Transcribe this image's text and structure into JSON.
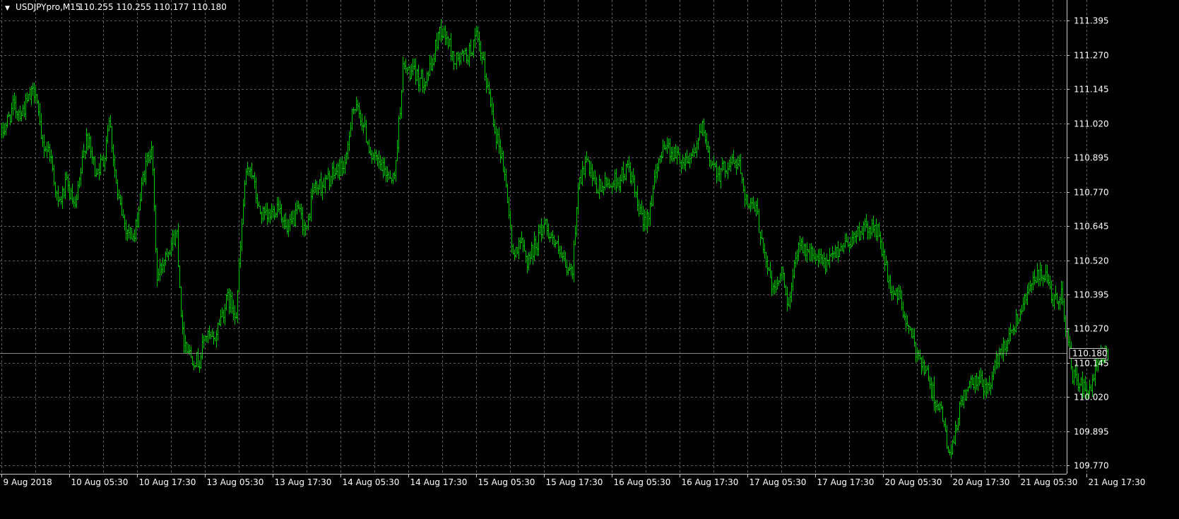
{
  "header": {
    "symbol_label": "USDJPYpro,M15",
    "quote_values": "110.255 110.255 110.177 110.180",
    "collapse_glyph": "▼"
  },
  "colors": {
    "background": "#000000",
    "bars": "#00c800",
    "grid": "#5a5a5a",
    "axis": "#c8c8c8",
    "text": "#ffffff",
    "current_price_line": "#8a8a8a"
  },
  "chart_data": {
    "type": "bar",
    "series": [
      {
        "name": "USDJPYpro,M15"
      }
    ],
    "current_price": 110.18,
    "current_price_label": "110.180",
    "ylim": [
      109.74,
      111.46
    ],
    "grid": true,
    "y_tick_values": [
      111.395,
      111.27,
      111.145,
      111.02,
      110.895,
      110.77,
      110.645,
      110.52,
      110.395,
      110.27,
      110.145,
      110.02,
      109.895,
      109.77
    ],
    "y_tick_labels": [
      "111.395",
      "111.270",
      "111.145",
      "111.020",
      "110.895",
      "110.770",
      "110.645",
      "110.520",
      "110.395",
      "110.270",
      "110.145",
      "110.020",
      "109.895",
      "109.770"
    ],
    "x_tick_labels": [
      "9 Aug 2018",
      "10 Aug 05:30",
      "10 Aug 17:30",
      "13 Aug 05:30",
      "13 Aug 17:30",
      "14 Aug 05:30",
      "14 Aug 17:30",
      "15 Aug 05:30",
      "15 Aug 17:30",
      "16 Aug 05:30",
      "16 Aug 17:30",
      "17 Aug 05:30",
      "17 Aug 17:30",
      "20 Aug 05:30",
      "20 Aug 17:30",
      "21 Aug 05:30",
      "21 Aug 17:30"
    ],
    "x_tick_index": [
      0,
      48,
      96,
      144,
      192,
      240,
      288,
      336,
      384,
      432,
      480,
      528,
      576,
      624,
      672,
      720,
      768
    ],
    "bar_count": 800,
    "close_anchors": [
      [
        0,
        110.98
      ],
      [
        8,
        111.08
      ],
      [
        14,
        111.06
      ],
      [
        24,
        111.15
      ],
      [
        28,
        110.95
      ],
      [
        34,
        110.92
      ],
      [
        40,
        110.72
      ],
      [
        46,
        110.8
      ],
      [
        52,
        110.7
      ],
      [
        60,
        110.98
      ],
      [
        66,
        110.85
      ],
      [
        72,
        110.88
      ],
      [
        76,
        111.05
      ],
      [
        82,
        110.75
      ],
      [
        88,
        110.64
      ],
      [
        94,
        110.6
      ],
      [
        100,
        110.82
      ],
      [
        106,
        110.95
      ],
      [
        110,
        110.45
      ],
      [
        116,
        110.55
      ],
      [
        124,
        110.62
      ],
      [
        128,
        110.25
      ],
      [
        134,
        110.17
      ],
      [
        140,
        110.15
      ],
      [
        144,
        110.25
      ],
      [
        150,
        110.22
      ],
      [
        154,
        110.3
      ],
      [
        160,
        110.38
      ],
      [
        166,
        110.33
      ],
      [
        172,
        110.8
      ],
      [
        176,
        110.87
      ],
      [
        182,
        110.7
      ],
      [
        188,
        110.67
      ],
      [
        196,
        110.73
      ],
      [
        202,
        110.62
      ],
      [
        210,
        110.7
      ],
      [
        216,
        110.62
      ],
      [
        220,
        110.78
      ],
      [
        228,
        110.8
      ],
      [
        236,
        110.84
      ],
      [
        244,
        110.88
      ],
      [
        248,
        111.08
      ],
      [
        254,
        111.05
      ],
      [
        262,
        110.9
      ],
      [
        270,
        110.85
      ],
      [
        278,
        110.82
      ],
      [
        284,
        111.22
      ],
      [
        292,
        111.2
      ],
      [
        298,
        111.18
      ],
      [
        304,
        111.22
      ],
      [
        310,
        111.37
      ],
      [
        316,
        111.32
      ],
      [
        320,
        111.25
      ],
      [
        330,
        111.27
      ],
      [
        336,
        111.33
      ],
      [
        340,
        111.25
      ],
      [
        346,
        111.1
      ],
      [
        350,
        110.98
      ],
      [
        354,
        110.9
      ],
      [
        358,
        110.75
      ],
      [
        362,
        110.52
      ],
      [
        366,
        110.6
      ],
      [
        372,
        110.52
      ],
      [
        378,
        110.58
      ],
      [
        384,
        110.66
      ],
      [
        390,
        110.6
      ],
      [
        394,
        110.55
      ],
      [
        400,
        110.48
      ],
      [
        404,
        110.48
      ],
      [
        408,
        110.8
      ],
      [
        414,
        110.88
      ],
      [
        420,
        110.78
      ],
      [
        430,
        110.8
      ],
      [
        438,
        110.82
      ],
      [
        444,
        110.86
      ],
      [
        450,
        110.72
      ],
      [
        454,
        110.65
      ],
      [
        458,
        110.7
      ],
      [
        462,
        110.8
      ],
      [
        468,
        110.95
      ],
      [
        474,
        110.92
      ],
      [
        482,
        110.88
      ],
      [
        490,
        110.92
      ],
      [
        496,
        111.0
      ],
      [
        500,
        110.9
      ],
      [
        508,
        110.84
      ],
      [
        516,
        110.88
      ],
      [
        522,
        110.87
      ],
      [
        528,
        110.72
      ],
      [
        534,
        110.7
      ],
      [
        540,
        110.55
      ],
      [
        546,
        110.4
      ],
      [
        552,
        110.48
      ],
      [
        556,
        110.36
      ],
      [
        560,
        110.45
      ],
      [
        564,
        110.6
      ],
      [
        570,
        110.55
      ],
      [
        578,
        110.52
      ],
      [
        584,
        110.5
      ],
      [
        590,
        110.55
      ],
      [
        596,
        110.58
      ],
      [
        602,
        110.6
      ],
      [
        608,
        110.63
      ],
      [
        616,
        110.64
      ],
      [
        620,
        110.62
      ],
      [
        624,
        110.55
      ],
      [
        628,
        110.42
      ],
      [
        634,
        110.4
      ],
      [
        640,
        110.3
      ],
      [
        646,
        110.2
      ],
      [
        652,
        110.15
      ],
      [
        658,
        110.05
      ],
      [
        664,
        109.98
      ],
      [
        668,
        109.88
      ],
      [
        672,
        109.8
      ],
      [
        676,
        109.92
      ],
      [
        680,
        110.02
      ],
      [
        686,
        110.06
      ],
      [
        692,
        110.08
      ],
      [
        698,
        110.05
      ],
      [
        704,
        110.15
      ],
      [
        710,
        110.22
      ],
      [
        716,
        110.28
      ],
      [
        720,
        110.32
      ],
      [
        726,
        110.42
      ],
      [
        732,
        110.45
      ],
      [
        738,
        110.47
      ],
      [
        744,
        110.36
      ],
      [
        750,
        110.4
      ],
      [
        754,
        110.25
      ],
      [
        758,
        110.1
      ],
      [
        764,
        110.06
      ],
      [
        770,
        110.03
      ],
      [
        776,
        110.15
      ],
      [
        780,
        110.18
      ],
      [
        783,
        110.18
      ]
    ]
  }
}
